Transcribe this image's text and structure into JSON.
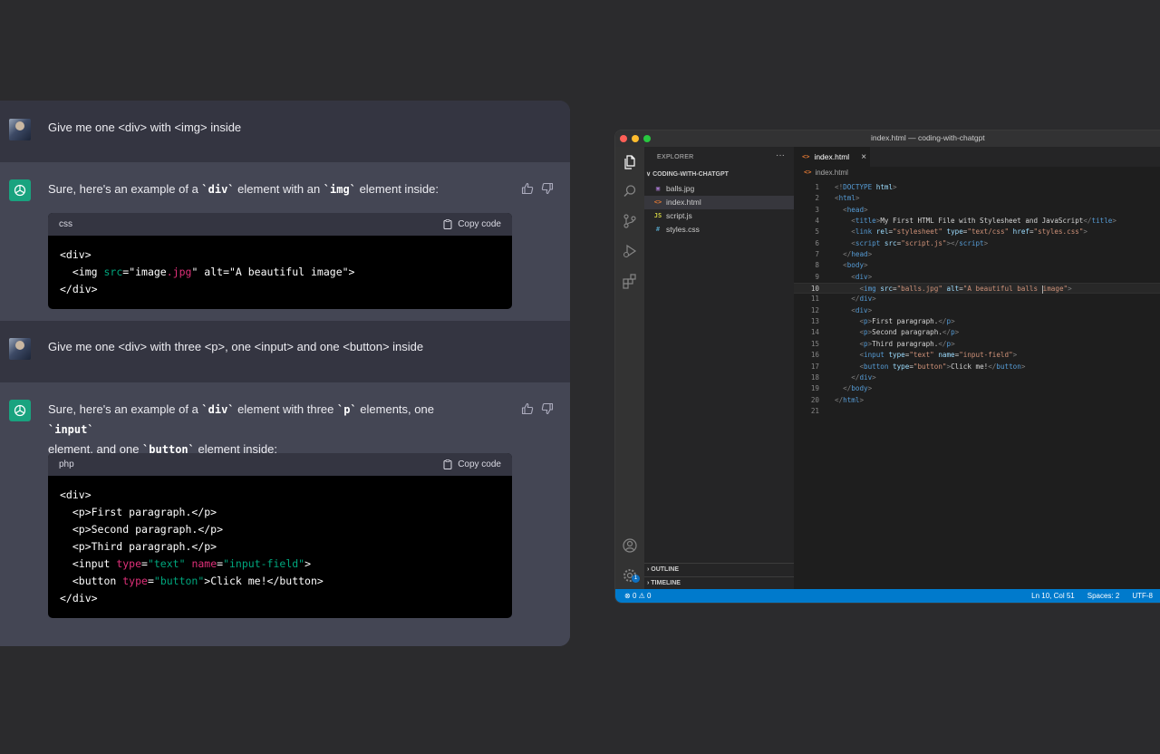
{
  "chat": {
    "messages": [
      {
        "role": "user",
        "text": "Give me one <div> with <img> inside"
      },
      {
        "role": "assistant",
        "intro_parts": [
          "Sure, here's an example of a ",
          "`div`",
          " element with an ",
          "`img`",
          " element inside:"
        ],
        "code": {
          "lang": "css",
          "copy_label": "Copy code"
        }
      },
      {
        "role": "user",
        "text": "Give me one <div> with three <p>, one <input> and one <button> inside"
      },
      {
        "role": "assistant",
        "intro_parts": [
          "Sure, here's an example of a ",
          "`div`",
          " element with three ",
          "`p`",
          " elements, one ",
          "`input`",
          "element, and one ",
          "`button`",
          " element inside:"
        ],
        "code": {
          "lang": "php",
          "copy_label": "Copy code"
        }
      }
    ],
    "code1": {
      "l1": "<div>",
      "l2a": "  <img ",
      "l2b": "src",
      "l2c": "=",
      "l2d": "\"image",
      "l2e": ".jpg",
      "l2f": "\"",
      "l2g": " alt=\"A beautiful image\">",
      "l3": "</div>"
    },
    "code2": {
      "l1": "<div>",
      "l2": "  <p>First paragraph.</p>",
      "l3": "  <p>Second paragraph.</p>",
      "l4": "  <p>Third paragraph.</p>",
      "l5a": "  <input ",
      "l5b": "type",
      "l5c": "=",
      "l5d": "\"text\"",
      "l5e": " ",
      "l5f": "name",
      "l5g": "=",
      "l5h": "\"input-field\"",
      "l5i": ">",
      "l6a": "  <button ",
      "l6b": "type",
      "l6c": "=",
      "l6d": "\"button\"",
      "l6e": ">Click me!</button>",
      "l7": "</div>"
    }
  },
  "vscode": {
    "window_title": "index.html — coding-with-chatgpt",
    "explorer_title": "EXPLORER",
    "explorer_more": "···",
    "folder": "CODING-WITH-CHATGPT",
    "files": [
      {
        "name": "balls.jpg",
        "icon": "image-icon",
        "glyph": "▣"
      },
      {
        "name": "index.html",
        "icon": "html-icon",
        "glyph": "<>"
      },
      {
        "name": "script.js",
        "icon": "js-icon",
        "glyph": "JS"
      },
      {
        "name": "styles.css",
        "icon": "css-icon",
        "glyph": "#"
      }
    ],
    "outline_label": "OUTLINE",
    "timeline_label": "TIMELINE",
    "tab_label": "index.html",
    "breadcrumb": "index.html",
    "current_line": 10,
    "status": {
      "errors": "0",
      "warnings": "0",
      "position": "Ln 10, Col 51",
      "spaces": "Spaces: 2",
      "encoding": "UTF-8"
    },
    "accounts_badge": "1"
  }
}
